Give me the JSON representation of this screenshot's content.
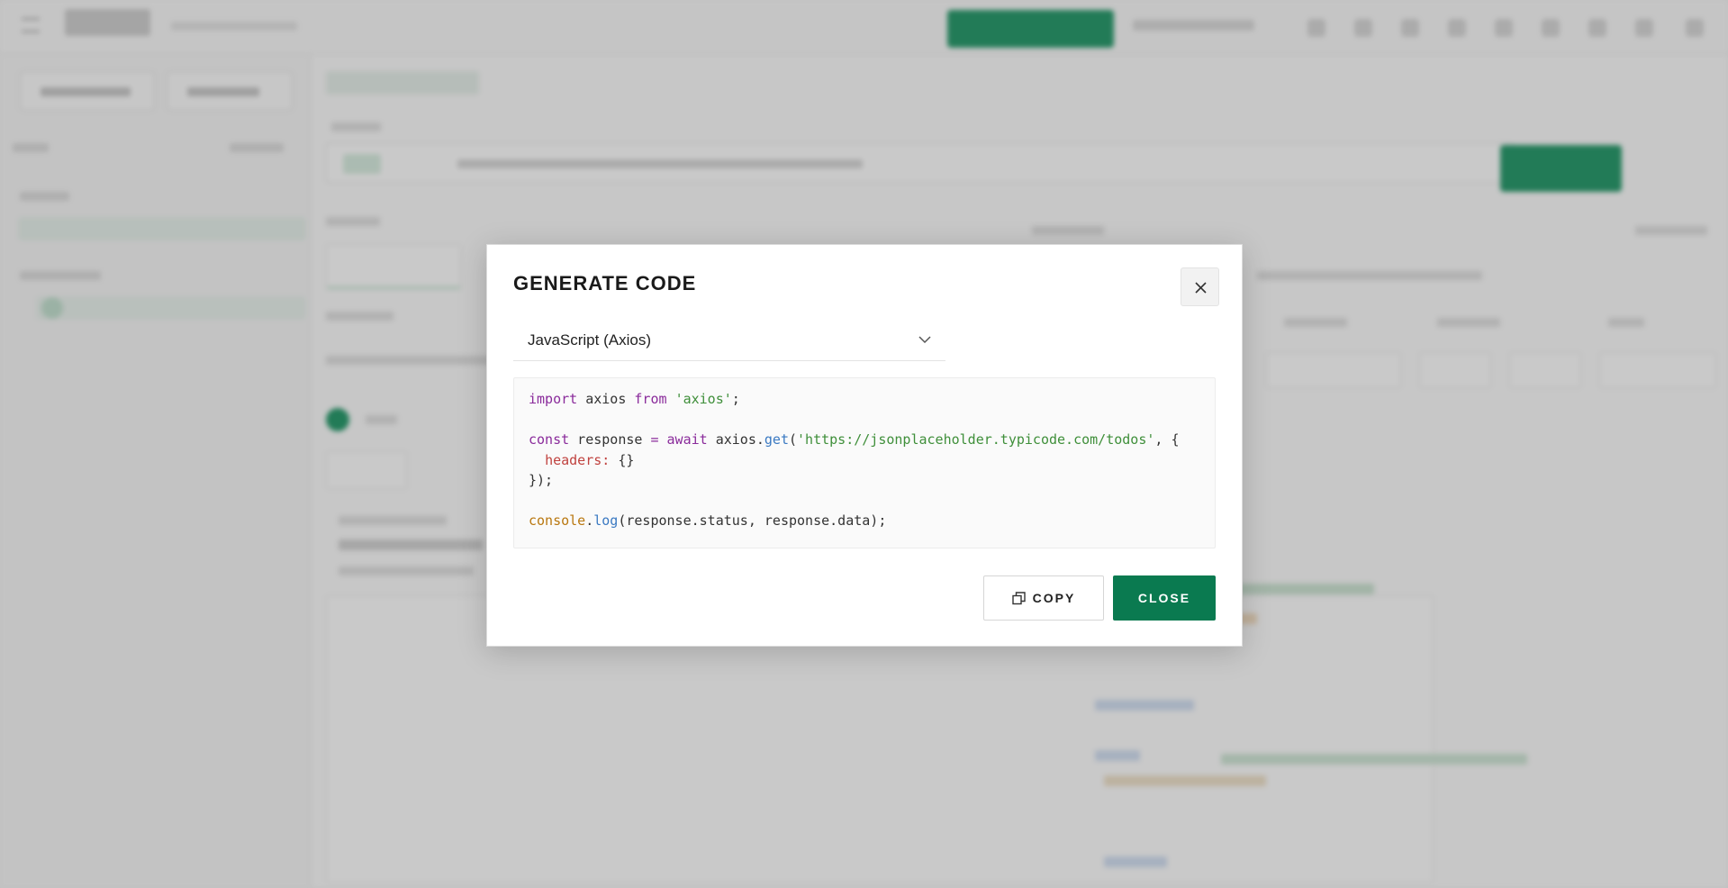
{
  "modal": {
    "title": "GENERATE CODE",
    "language": "JavaScript (Axios)",
    "code_lines": [
      "import axios from 'axios';",
      "",
      "const response = await axios.get('https://jsonplaceholder.typicode.com/todos', {",
      "  headers: {}",
      "});",
      "",
      "console.log(response.status, response.data);"
    ],
    "copy_label": "COPY",
    "close_label": "CLOSE"
  },
  "colors": {
    "accent": "#0a7a50",
    "keyword": "#8a2b9b",
    "string": "#3f8f3a",
    "function": "#3a79c2",
    "property": "#c0423f",
    "console": "#b9770f"
  },
  "icons": {
    "close": "close-icon",
    "dropdown": "chevron-down-icon",
    "copy": "copy-icon"
  }
}
